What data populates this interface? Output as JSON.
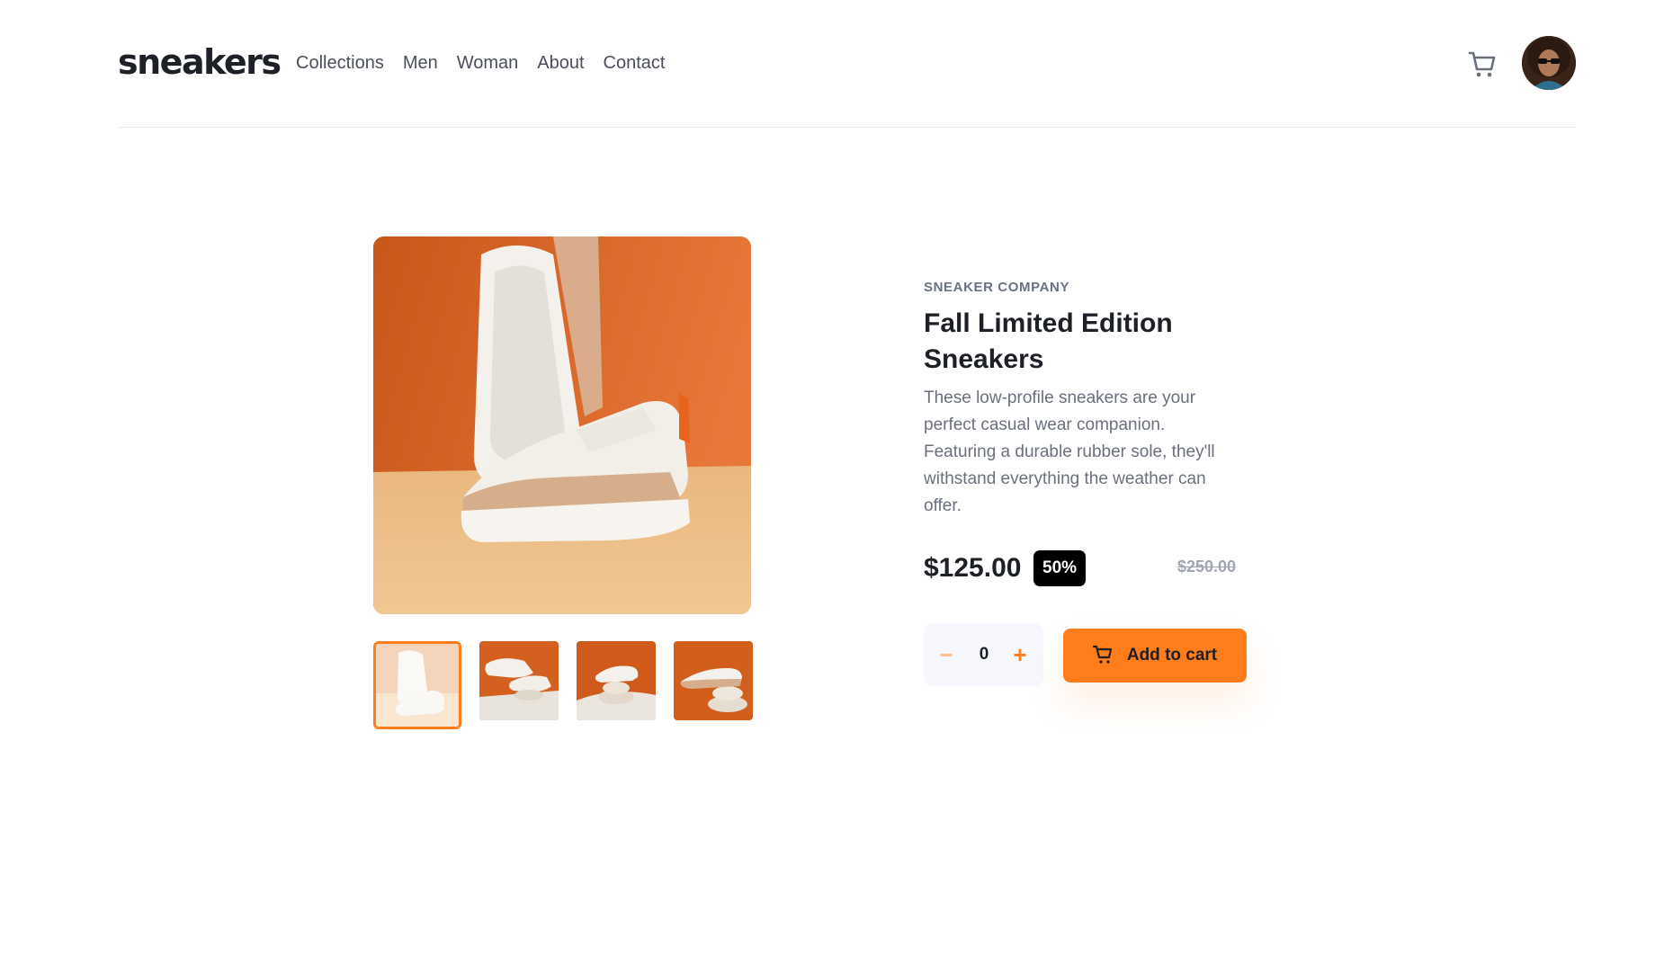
{
  "header": {
    "logo": "sneakers",
    "nav": [
      "Collections",
      "Men",
      "Woman",
      "About",
      "Contact"
    ],
    "cart_icon": "cart-icon",
    "avatar_icon": "avatar"
  },
  "gallery": {
    "main_image": "sneaker-product-photo",
    "thumbnails": [
      "thumbnail-1",
      "thumbnail-2",
      "thumbnail-3",
      "thumbnail-4"
    ],
    "active_thumbnail": 1
  },
  "product": {
    "company": "SNEAKER COMPANY",
    "title": "Fall Limited Edition Sneakers",
    "description": "These low-profile sneakers are your perfect casual wear companion. Featuring a durable rubber sole, they'll withstand everything the weather can offer.",
    "price": "$125.00",
    "discount": "50%",
    "old_price": "$250.00",
    "quantity": "0",
    "minus_label": "−",
    "plus_label": "+",
    "add_to_cart_label": "Add to cart"
  },
  "colors": {
    "accent": "#ff7d1a",
    "text_dark": "#1d2026",
    "text_gray": "#6a707c",
    "qty_bg": "#f6f8fd"
  }
}
